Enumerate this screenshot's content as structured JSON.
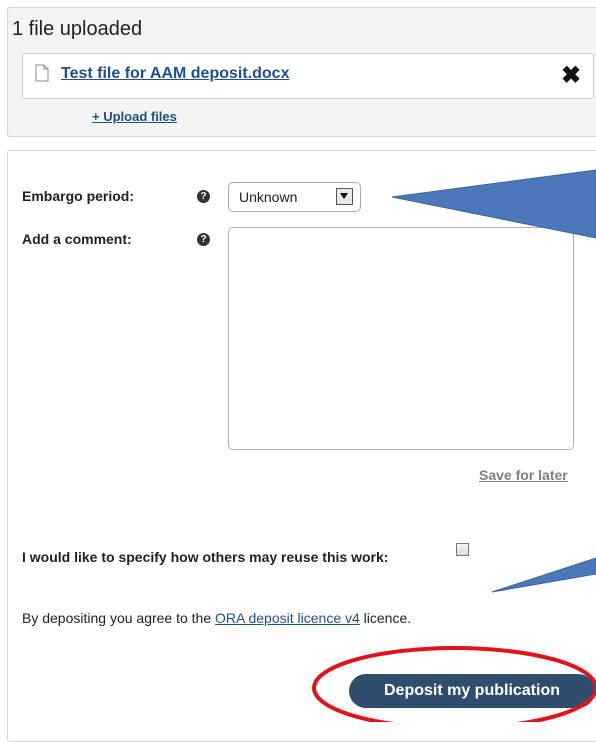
{
  "upload": {
    "heading": "1 file uploaded",
    "file_name": "Test file for AAM deposit.docx",
    "upload_files_label": "+ Upload files"
  },
  "form": {
    "embargo_label": "Embargo period:",
    "embargo_value": "Unknown",
    "comment_label": "Add a comment:",
    "comment_value": "",
    "save_for_later_label": "Save for later",
    "reuse_label": "I would like to specify how others may reuse this work:",
    "reuse_checked": false,
    "agree_prefix": "By depositing you agree to the ",
    "agree_link": "ORA deposit licence v4",
    "agree_suffix": " licence.",
    "deposit_button": "Deposit my publication"
  },
  "icons": {
    "file": "document-icon",
    "remove": "close-icon",
    "help": "help-icon",
    "dropdown": "chevron-down-icon"
  },
  "colors": {
    "link": "#1f4f8f",
    "button_bg": "#2f4d6c",
    "callout": "#4a78b8",
    "highlight_ring": "#e0131b"
  }
}
